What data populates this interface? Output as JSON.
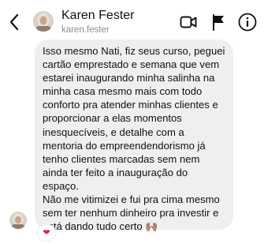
{
  "header": {
    "name": "Karen Fester",
    "username": "karen.fester",
    "icons": [
      "back-arrow-icon",
      "video-camera-icon",
      "flag-icon",
      "info-icon"
    ]
  },
  "message": {
    "lines": [
      "Isso mesmo Nati, fiz seus curso, peguei",
      "cartão emprestado e semana que vem",
      "estarei inaugurando minha salinha na",
      "minha casa mesmo mais com todo",
      "conforto pra atender minhas clientes e",
      "proporcionar a elas momentos",
      "inesquecíveis, e detalhe com a",
      "mentoria do empreendendorismo já",
      "tenho clientes marcadas sem nem",
      "ainda ter feito a inauguração do",
      "espaço.",
      "Não me vitimizei e fui pra cima mesmo",
      "sem ter nenhum dinheiro pra investir e",
      "está dando tudo certo 🙌🏽"
    ]
  },
  "reaction": {
    "emoji": "❤"
  },
  "colors": {
    "bubble": "#efefef",
    "secondary_text": "#8e8e8e",
    "heart": "#e0245e"
  }
}
